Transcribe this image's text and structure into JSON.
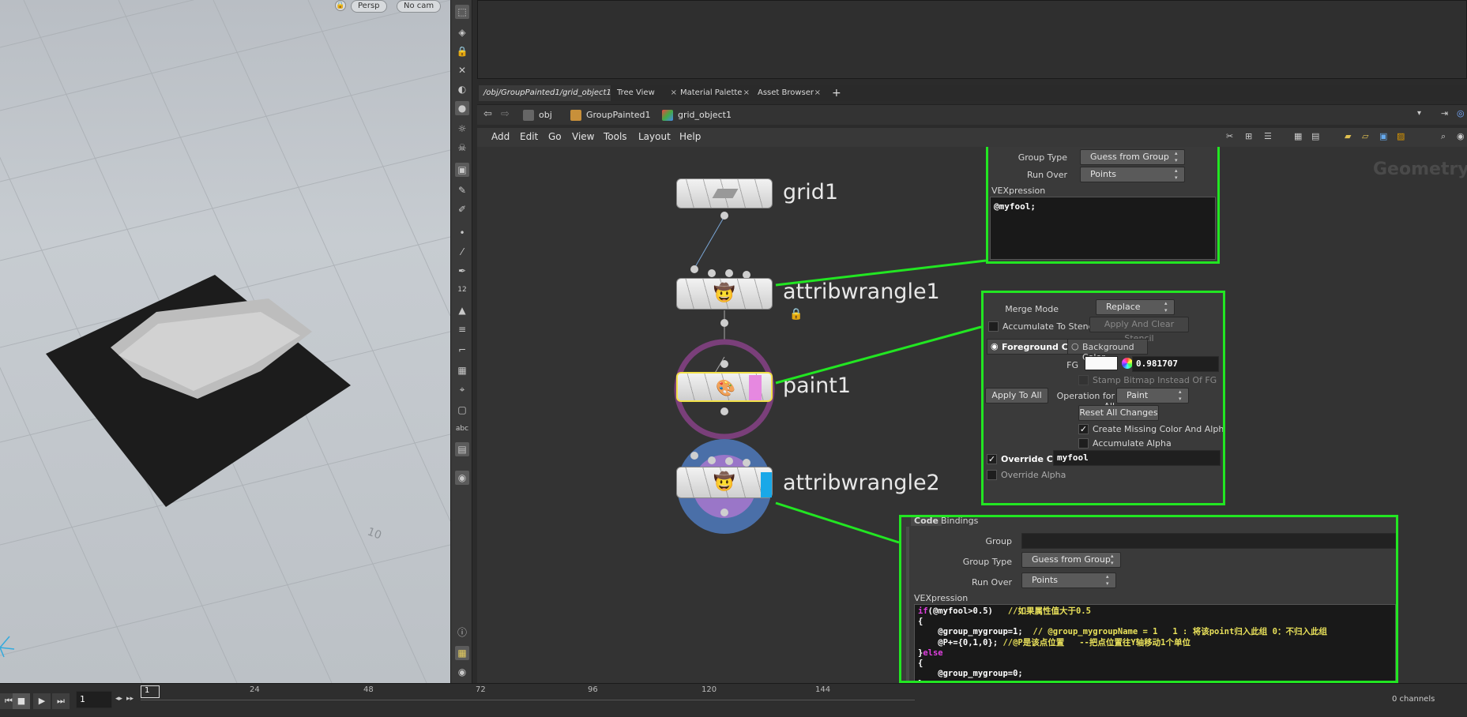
{
  "viewport": {
    "lock_icon": "lock-icon",
    "persp_label": "Persp",
    "cam_label": "No cam",
    "grid_label": "10"
  },
  "tabs": [
    {
      "label": "/obj/GroupPainted1/grid_object1"
    },
    {
      "label": "Tree View"
    },
    {
      "label": "Material Palette"
    },
    {
      "label": "Asset Browser"
    }
  ],
  "path": {
    "obj": "obj",
    "group": "GroupPainted1",
    "grid": "grid_object1"
  },
  "menu": [
    "Add",
    "Edit",
    "Go",
    "View",
    "Tools",
    "Layout",
    "Help"
  ],
  "network": {
    "watermark": "Geometry",
    "nodes": [
      {
        "name": "grid1"
      },
      {
        "name": "attribwrangle1"
      },
      {
        "name": "paint1"
      },
      {
        "name": "attribwrangle2"
      }
    ]
  },
  "panel1": {
    "group_type_label": "Group Type",
    "group_type_value": "Guess from Group",
    "run_over_label": "Run Over",
    "run_over_value": "Points",
    "vex_label": "VEXpression",
    "code": "@myfool;"
  },
  "panel2": {
    "merge_mode_label": "Merge Mode",
    "merge_mode_value": "Replace",
    "accumulate_stencil": "Accumulate To Stencil",
    "apply_clear_stencil": "Apply And Clear Stencil",
    "fg_color": "Foreground Color",
    "bg_color": "Background Color",
    "fg_label": "FG",
    "fg_value": "0.981707",
    "stamp_bitmap": "Stamp Bitmap Instead Of FG",
    "apply_all": "Apply To All",
    "operation_label": "Operation for All",
    "operation_value": "Paint",
    "reset_all": "Reset All Changes",
    "create_missing": "Create Missing Color And Alpha",
    "accumulate_alpha": "Accumulate Alpha",
    "override_color": "Override Color",
    "override_value": "myfool",
    "override_alpha": "Override Alpha"
  },
  "panel3": {
    "tab_code": "Code",
    "tab_bindings": "Bindings",
    "group_label": "Group",
    "group_value": "",
    "group_type_label": "Group Type",
    "group_type_value": "Guess from Group",
    "run_over_label": "Run Over",
    "run_over_value": "Points",
    "vex_label": "VEXpression",
    "code_lines": [
      "if(@myfool>0.5)   //如果属性值大于0.5",
      "{",
      "    @group_mygroup=1;  // @group_mygroupName = 1   1 : 将该point归入此组 0：不归入此组",
      "    @P+={0,1,0}; //@P是该点位置   --把点位置往Y轴移动1个单位",
      "}else",
      "{",
      "    @group_mygroup=0;",
      "}"
    ]
  },
  "timeline": {
    "frame": "1",
    "marker": "1",
    "ticks": [
      "24",
      "48",
      "72",
      "96",
      "120",
      "144"
    ],
    "channels": "0 channels"
  }
}
